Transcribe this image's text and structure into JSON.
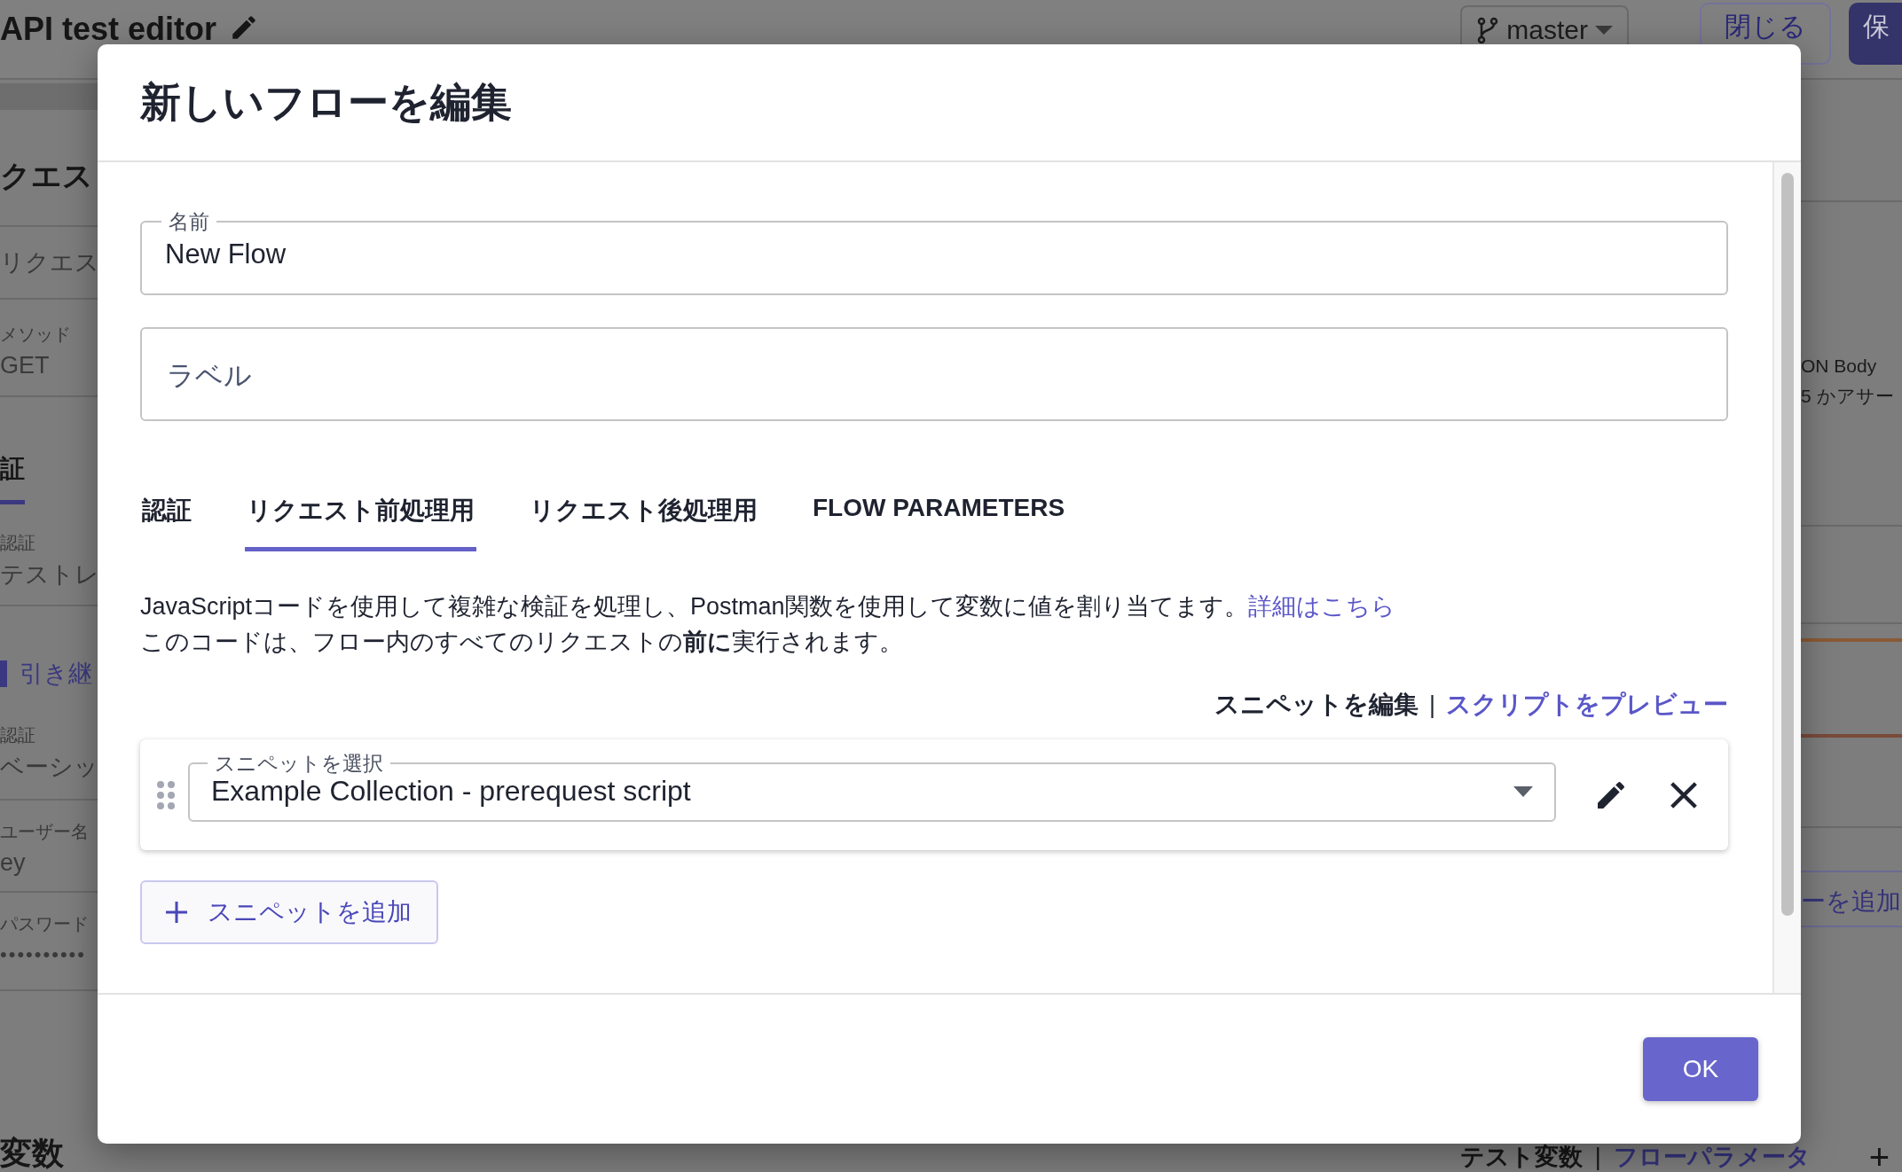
{
  "background": {
    "app_title": "API test editor",
    "branch": "master",
    "close_button": "閉じる",
    "save_button": "保",
    "left_panel": {
      "heading": "クエス",
      "request_name": "リクエス",
      "method_label": "メソッド",
      "method": "GET",
      "tabs": [
        {
          "label": "証",
          "selected": true
        }
      ],
      "auth_label": "認証",
      "auth_value": "テストレ",
      "inherit_link": "引き継",
      "auth_type_label": "認証",
      "auth_type": "ベーシッ",
      "username_label": "ユーザー名",
      "username": "ey",
      "password_label": "パスワード",
      "password": "••••••••••"
    },
    "right_panel": {
      "description_lines": [
        "ON Body",
        "5 かアサー"
      ],
      "add_link": "ーを追加"
    },
    "variables_heading": "変数",
    "bottom_links": [
      {
        "label": "テスト変数",
        "selected": true
      },
      {
        "label": "フローパラメータ",
        "selected": false
      }
    ],
    "bottom_separator": "|",
    "add_symbol": "+"
  },
  "dialog": {
    "title": "新しいフローを編集",
    "name_field": {
      "label": "名前",
      "value": "New Flow"
    },
    "label_field": {
      "placeholder": "ラベル"
    },
    "tabs": [
      {
        "label": "認証",
        "selected": false
      },
      {
        "label": "リクエスト前処理用",
        "selected": true
      },
      {
        "label": "リクエスト後処理用",
        "selected": false
      },
      {
        "label": "FLOW PARAMETERS",
        "selected": false
      }
    ],
    "description": "JavaScriptコードを使用して複雑な検証を処理し、Postman関数を使用して変数に値を割り当てます。",
    "learn_more_link": "詳細はこちら",
    "note": "このコードは、フロー内のすべてのリクエストの**前に**実行されます。",
    "snippet_actions": [
      {
        "label": "スニペットを編集",
        "selected": true
      },
      {
        "label": "スクリプトをプレビュー",
        "selected": false
      }
    ],
    "snippet_separator": "|",
    "snippets": [
      {
        "label": "スニペットを選択",
        "value": "Example Collection - prerequest script"
      }
    ],
    "add_snippet_button": "スニペットを追加",
    "ok_button": "OK"
  }
}
